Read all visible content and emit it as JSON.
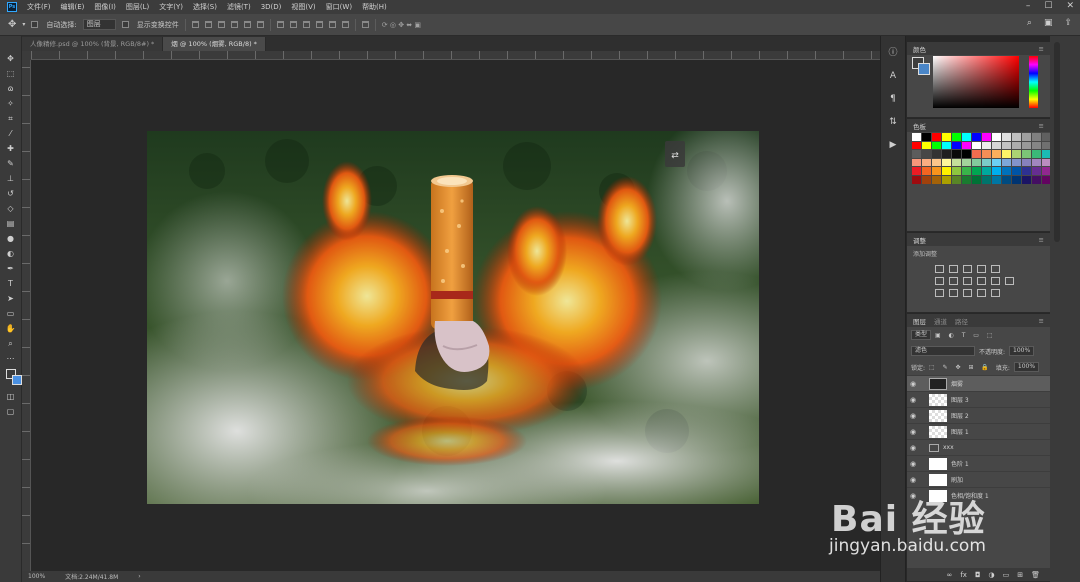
{
  "menubar": {
    "items": [
      "文件(F)",
      "编辑(E)",
      "图像(I)",
      "图层(L)",
      "文字(Y)",
      "选择(S)",
      "滤镜(T)",
      "3D(D)",
      "视图(V)",
      "窗口(W)",
      "帮助(H)"
    ]
  },
  "options": {
    "auto_select_label": "自动选择:",
    "auto_select_value": "图层",
    "transform_label": "显示变换控件"
  },
  "tabs": [
    {
      "label": "人像精修.psd @ 100% (背景, RGB/8#) *",
      "active": false
    },
    {
      "label": "烟 @ 100% (烟雾, RGB/8) *",
      "active": true
    }
  ],
  "status": {
    "zoom": "100%",
    "doc": "文档:2.24M/41.8M"
  },
  "panels": {
    "color_title": "颜色",
    "swatches_title": "色板",
    "adjust_title": "调整",
    "adjust_sub": "添加调整"
  },
  "layers": {
    "tabs": [
      "图层",
      "通道",
      "路径"
    ],
    "kind": "类型",
    "blend": "滤色",
    "opacity_label": "不透明度:",
    "opacity_value": "100%",
    "lock_label": "锁定:",
    "fill_label": "填充:",
    "fill_value": "100%",
    "items": [
      {
        "name": "烟雾",
        "thumb": "dark",
        "selected": true
      },
      {
        "name": "图层 3",
        "thumb": "checker",
        "selected": false
      },
      {
        "name": "图层 2",
        "thumb": "checker",
        "selected": false
      },
      {
        "name": "图层 1",
        "thumb": "checker",
        "selected": false
      },
      {
        "name": "xxx",
        "thumb": "folder",
        "selected": false
      },
      {
        "name": "色阶 1",
        "thumb": "white",
        "selected": false
      },
      {
        "name": "刷加",
        "thumb": "white",
        "selected": false
      },
      {
        "name": "色相/饱和度 1",
        "thumb": "white",
        "selected": false
      }
    ]
  },
  "watermark": {
    "brand": "Bai 经验",
    "url": "jingyan.baidu.com"
  },
  "swatch_colors": [
    "#ffffff",
    "#000000",
    "#ff0000",
    "#ffff00",
    "#00ff00",
    "#00ffff",
    "#0000ff",
    "#ff00ff",
    "#ffffff",
    "#e0e0e0",
    "#c0c0c0",
    "#a0a0a0",
    "#808080",
    "#606060",
    "#ff0000",
    "#ffff00",
    "#00ff00",
    "#00ffff",
    "#0000ff",
    "#ff00ff",
    "#ffffff",
    "#ebebeb",
    "#d6d6d6",
    "#c2c2c2",
    "#adadad",
    "#999999",
    "#858585",
    "#707070",
    "#5c5c5c",
    "#474747",
    "#333333",
    "#1f1f1f",
    "#0a0a0a",
    "#000000",
    "#f26c4f",
    "#f68e56",
    "#fbaf5c",
    "#fff467",
    "#acd372",
    "#7cc576",
    "#3bb878",
    "#1abbb4",
    "#f7977a",
    "#f9ad81",
    "#fdc68a",
    "#fff79a",
    "#c4df9b",
    "#a3d39c",
    "#82ca9c",
    "#7accc8",
    "#6dcff6",
    "#7da7d9",
    "#8393ca",
    "#8781bd",
    "#a186be",
    "#bc8dbf",
    "#ed1c24",
    "#f26522",
    "#f7941d",
    "#fff200",
    "#8dc63f",
    "#39b54a",
    "#00a651",
    "#00a99d",
    "#00aeef",
    "#0072bc",
    "#0054a6",
    "#2e3192",
    "#662d91",
    "#92278f",
    "#9e0b0f",
    "#a0410d",
    "#a36209",
    "#aba000",
    "#598527",
    "#1a7b30",
    "#007236",
    "#00746b",
    "#0076a3",
    "#004b80",
    "#003471",
    "#1b1464",
    "#440e62",
    "#630460"
  ]
}
